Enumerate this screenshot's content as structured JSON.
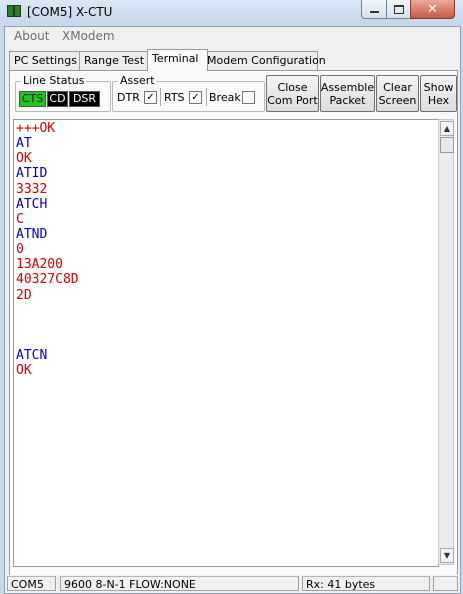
{
  "window": {
    "title": "[COM5] X-CTU",
    "close_glyph": "✕"
  },
  "menu": {
    "items": [
      "About",
      "XModem"
    ]
  },
  "tabs": [
    "PC Settings",
    "Range Test",
    "Terminal",
    "Modem Configuration"
  ],
  "active_tab": "Terminal",
  "line_status": {
    "label": "Line Status",
    "indicators": [
      "CTS",
      "CD",
      "DSR"
    ],
    "colors": {
      "CTS": "#1ec71e",
      "CD": "#000000",
      "DSR": "#000000"
    }
  },
  "assert": {
    "label": "Assert",
    "dtr": {
      "label": "DTR",
      "checked": true
    },
    "rts": {
      "label": "RTS",
      "checked": true
    },
    "break": {
      "label": "Break",
      "checked": false
    }
  },
  "buttons": {
    "close_com_port": "Close\nCom Port",
    "assemble_packet": "Assemble\nPacket",
    "clear_screen": "Clear\nScreen",
    "show_hex": "Show\nHex"
  },
  "terminal": {
    "colors": {
      "sent": "#0000d4",
      "received": "#d40000"
    },
    "lines": [
      {
        "text": "+++OK",
        "color": "red"
      },
      {
        "text": "AT",
        "color": "blue"
      },
      {
        "text": "OK",
        "color": "red"
      },
      {
        "text": "ATID",
        "color": "blue"
      },
      {
        "text": "3332",
        "color": "red"
      },
      {
        "text": "ATCH",
        "color": "blue"
      },
      {
        "text": "C",
        "color": "red"
      },
      {
        "text": "ATND",
        "color": "blue"
      },
      {
        "text": "0",
        "color": "red"
      },
      {
        "text": "13A200",
        "color": "red"
      },
      {
        "text": "40327C8D",
        "color": "red"
      },
      {
        "text": "2D",
        "color": "red"
      },
      {
        "text": "",
        "color": "red"
      },
      {
        "text": "",
        "color": "red"
      },
      {
        "text": "",
        "color": "red"
      },
      {
        "text": "ATCN",
        "color": "blue"
      },
      {
        "text": "OK",
        "color": "red"
      }
    ]
  },
  "statusbar": {
    "port": "COM5",
    "settings": "9600 8-N-1  FLOW:NONE",
    "rx": "Rx: 41 bytes"
  },
  "icons": {
    "scroll_up": "▲",
    "scroll_down": "▼",
    "check": "✓"
  }
}
